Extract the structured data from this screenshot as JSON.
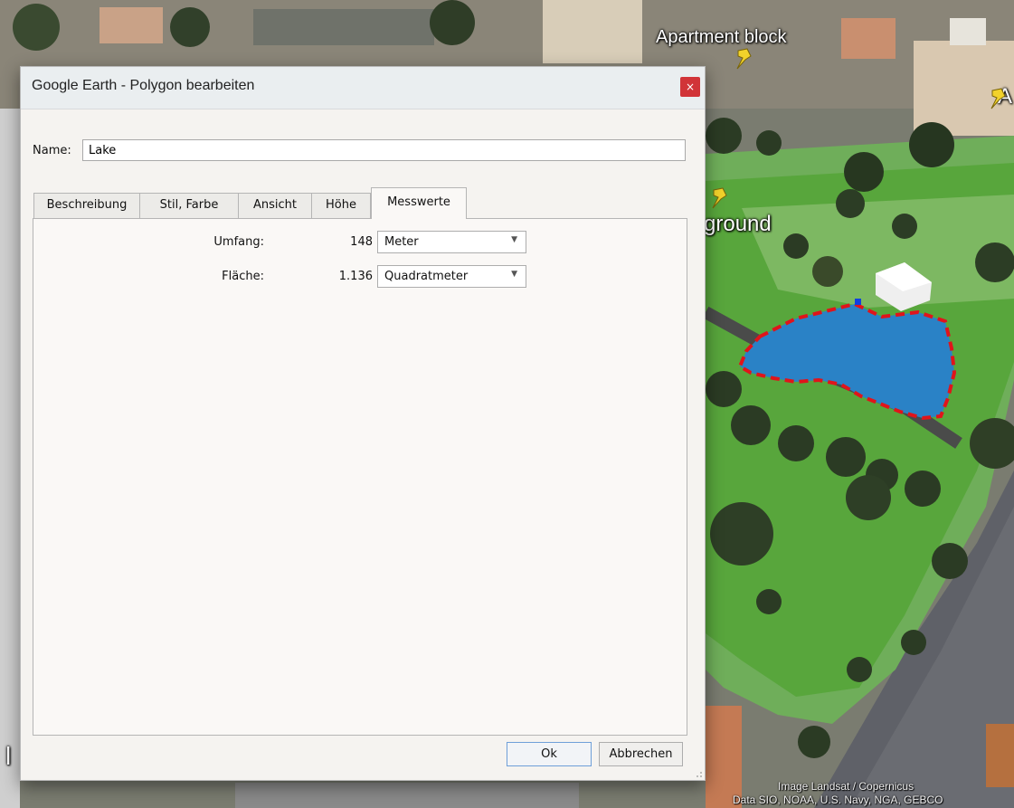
{
  "map": {
    "labels": {
      "apartment_block": "Apartment block",
      "clipped_a": "A",
      "ground": "ground",
      "clipped_left": "l"
    },
    "credits": {
      "line1": "Image Landsat / Copernicus",
      "line2": "Data SIO, NOAA, U.S. Navy, NGA, GEBCO"
    },
    "pin_icon": "yellow-pushpin-icon"
  },
  "dialog": {
    "title": "Google Earth - Polygon bearbeiten",
    "close_icon": "×",
    "name_label": "Name:",
    "name_value": "Lake",
    "tabs": [
      {
        "label": "Beschreibung",
        "active": false
      },
      {
        "label": "Stil, Farbe",
        "active": false
      },
      {
        "label": "Ansicht",
        "active": false
      },
      {
        "label": "Höhe",
        "active": false
      },
      {
        "label": "Messwerte",
        "active": true
      }
    ],
    "measurements": {
      "perimeter": {
        "label": "Umfang:",
        "value": "148",
        "unit": "Meter"
      },
      "area": {
        "label": "Fläche:",
        "value": "1.136",
        "unit": "Quadratmeter"
      }
    },
    "buttons": {
      "ok": "Ok",
      "cancel": "Abbrechen"
    }
  }
}
